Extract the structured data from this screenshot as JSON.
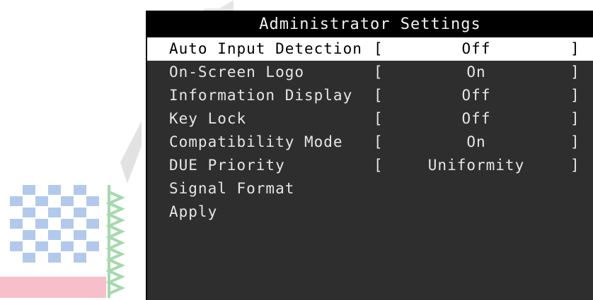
{
  "menu": {
    "title": "Administrator Settings",
    "rows": [
      {
        "label": "Auto Input Detection",
        "value": "Off",
        "open_bracket": "[",
        "close_bracket": "]",
        "selected": true
      },
      {
        "label": "On-Screen Logo",
        "value": "On",
        "open_bracket": "[",
        "close_bracket": "]",
        "selected": false
      },
      {
        "label": "Information Display",
        "value": "Off",
        "open_bracket": "[",
        "close_bracket": "]",
        "selected": false
      },
      {
        "label": "Key Lock",
        "value": "Off",
        "open_bracket": "[",
        "close_bracket": "]",
        "selected": false
      },
      {
        "label": "Compatibility Mode",
        "value": "On",
        "open_bracket": "[",
        "close_bracket": "]",
        "selected": false
      },
      {
        "label": "DUE Priority",
        "value": "Uniformity",
        "open_bracket": "[",
        "close_bracket": "]",
        "selected": false
      },
      {
        "label": "Signal Format"
      },
      {
        "label": "Apply"
      }
    ]
  },
  "colors": {
    "menu_background": "#2e2e2e",
    "title_background": "#000000",
    "selected_row_background": "#ffffff",
    "text": "#e6e6e6"
  }
}
